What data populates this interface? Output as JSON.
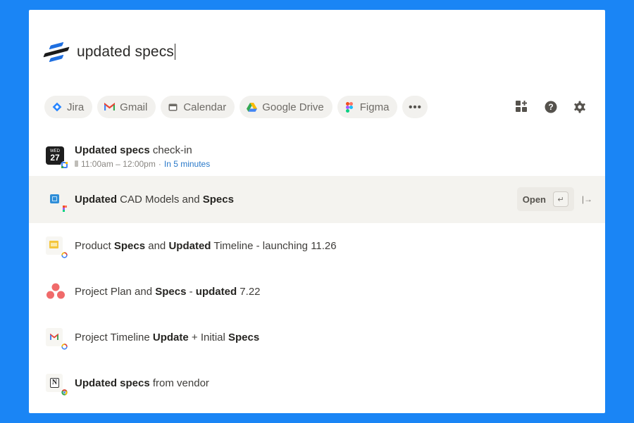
{
  "search": {
    "query": "updated specs",
    "logo": "dropbox-dash-logo"
  },
  "filters": [
    {
      "label": "Jira",
      "icon": "jira-icon",
      "color": "#2684ff"
    },
    {
      "label": "Gmail",
      "icon": "gmail-icon",
      "color": "#ea4335"
    },
    {
      "label": "Calendar",
      "icon": "calendar-icon",
      "color": "#6e6b66"
    },
    {
      "label": "Google Drive",
      "icon": "google-drive-icon",
      "color": "#34a853"
    },
    {
      "label": "Figma",
      "icon": "figma-icon",
      "color": "#f24e1e"
    },
    {
      "label": "•••",
      "icon": "more-icon"
    }
  ],
  "toolbar": {
    "apps_icon": "add-apps-icon",
    "help_icon": "help-icon",
    "settings_icon": "gear-icon"
  },
  "results": [
    {
      "icon": "calendar-event-icon",
      "date_day": "WED",
      "date_num": "27",
      "title_bold": "Updated specs",
      "title_rest": " check-in",
      "time": "11:00am – 12:00pm",
      "separator": "·",
      "relative": "In 5 minutes"
    },
    {
      "icon": "cad-file-icon",
      "parts": [
        {
          "t": "Updated",
          "b": true
        },
        {
          "t": " CAD Models and ",
          "b": false
        },
        {
          "t": "Specs",
          "b": true
        }
      ],
      "action_label": "Open",
      "action_key": "↵",
      "side_action": "|→",
      "selected": true
    },
    {
      "icon": "google-slides-icon",
      "parts": [
        {
          "t": "Product ",
          "b": false
        },
        {
          "t": "Specs",
          "b": true
        },
        {
          "t": " and ",
          "b": false
        },
        {
          "t": "Updated",
          "b": true
        },
        {
          "t": " Timeline - launching 11.26",
          "b": false
        }
      ]
    },
    {
      "icon": "asana-icon",
      "parts": [
        {
          "t": "Project Plan and ",
          "b": false
        },
        {
          "t": "Specs",
          "b": true
        },
        {
          "t": " - ",
          "b": false
        },
        {
          "t": "updated",
          "b": true
        },
        {
          "t": " 7.22",
          "b": false
        }
      ]
    },
    {
      "icon": "gmail-icon",
      "parts": [
        {
          "t": "Project Timeline ",
          "b": false
        },
        {
          "t": "Update",
          "b": true
        },
        {
          "t": " + Initial ",
          "b": false
        },
        {
          "t": "Specs",
          "b": true
        }
      ]
    },
    {
      "icon": "notion-icon",
      "parts": [
        {
          "t": "Updated specs",
          "b": true
        },
        {
          "t": " from vendor",
          "b": false
        }
      ]
    }
  ],
  "colors": {
    "background": "#1a85f5",
    "panel": "#ffffff",
    "chip": "#f2f1ee",
    "selected_row": "#f4f3ef",
    "link_blue": "#2a79c9"
  }
}
